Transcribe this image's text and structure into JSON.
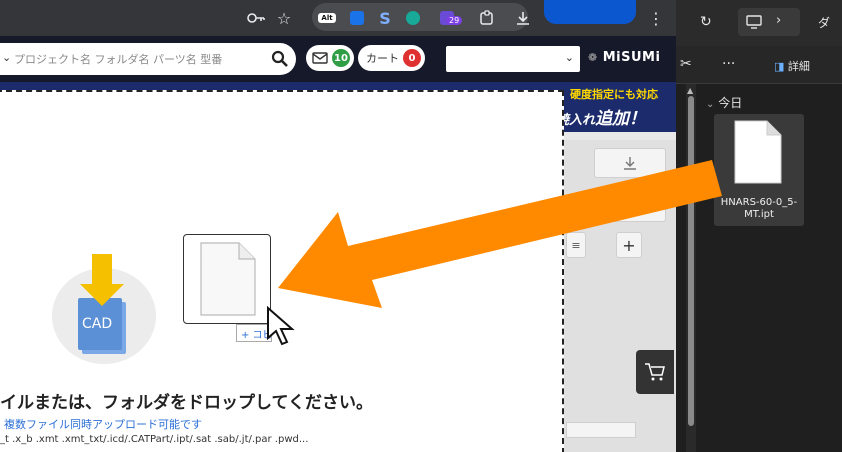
{
  "browser": {
    "ext_badge_29": "29",
    "ext_alt": "Alt"
  },
  "header": {
    "search_placeholder": "プロジェクト名  フォルダ名  パーツ名  型番",
    "messages_count": "10",
    "cart_label": "カート",
    "cart_count": "0",
    "logo_text": "MiSUMi"
  },
  "banner": {
    "line1": "硬度指定にも対応",
    "line2_small": "焼入れ",
    "line2_big": "追加！"
  },
  "dropzone": {
    "cad_label": "CAD",
    "copy_tag": "+ コピー",
    "title": "イルまたは、フォルダをドロップしてください。",
    "subtitle": "複数ファイル同時アップロード可能です",
    "extensions": "_t .x_b .xmt .xmt_txt/.icd/.CATPart/.ipt/.sat .sab/.jt/.par .pwd..."
  },
  "explorer": {
    "details_label": "詳細",
    "group_label": "今日",
    "file_name": "HNARS-60-0_5-MT.ipt",
    "title_partial": "ダ"
  },
  "colors": {
    "arrow": "#ff8a00",
    "header_bg": "#16192a",
    "explorer_bg": "#1f1f1f",
    "cad_blue": "#5b8fd6",
    "cad_yellow": "#f5c000"
  }
}
